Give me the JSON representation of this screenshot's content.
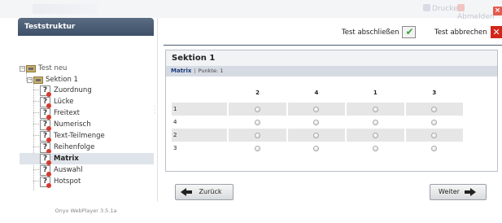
{
  "topbar": {
    "print_label": "Drucken",
    "logout_label": "Abmelden"
  },
  "left": {
    "header": "Teststruktur",
    "tree": {
      "root": "Test neu",
      "section": "Sektion 1",
      "items": [
        "Zuordnung",
        "Lücke",
        "Freitext",
        "Numerisch",
        "Text-Teilmenge",
        "Reihenfolge",
        "Matrix",
        "Auswahl",
        "Hotspot"
      ],
      "selected": "Matrix"
    },
    "version": "Onyx WebPlayer 3.5.1a"
  },
  "header": {
    "finish_label": "Test abschließen",
    "cancel_label": "Test abbrechen"
  },
  "section": {
    "title": "Sektion 1",
    "question_type": "Matrix",
    "separator": "|",
    "points": "Punkte: 1"
  },
  "matrix": {
    "columns": [
      "2",
      "4",
      "1",
      "3"
    ],
    "rows": [
      "1",
      "4",
      "2",
      "3"
    ]
  },
  "nav": {
    "back_label": "Zurück",
    "next_label": "Weiter"
  },
  "colors": {
    "header_bar": "#4a5c72",
    "selected_bg": "#dfe3ea",
    "cancel_red": "#d2251a",
    "confirm_green": "#3aa33a",
    "meta_bar": "#d6dae3"
  }
}
